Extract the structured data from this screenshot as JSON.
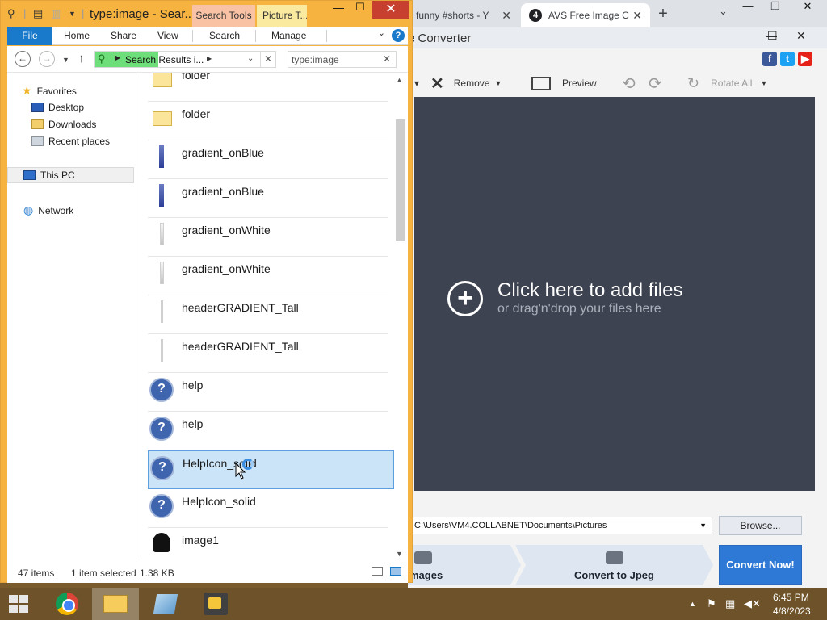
{
  "browser": {
    "tab1_title": "funny #shorts - Y",
    "tab2_title": "AVS Free Image C",
    "tab2_badge": "4",
    "new_tab": "+",
    "tab_search": "⌄",
    "minimize": "—",
    "restore": "❐",
    "close": "✕"
  },
  "avs": {
    "title": "e Converter",
    "minimize": "—",
    "maximize": "☐",
    "close": "✕",
    "toolbar": {
      "remove": "Remove",
      "preview": "Preview",
      "rotate_all": "Rotate All"
    },
    "canvas": {
      "add_main": "Click here to add files",
      "add_sub": "or drag'n'drop your files here"
    },
    "output_path": "C:\\Users\\VM4.COLLABNET\\Documents\\Pictures",
    "browse": "Browse...",
    "step1_label": "mages",
    "step2_label": "Convert to Jpeg",
    "convert_now": "Convert Now!"
  },
  "explorer": {
    "title": "type:image - Sear...",
    "ctx_search_tools": "Search Tools",
    "ctx_picture_tools": "Picture T...",
    "ribbon_tabs": [
      "File",
      "Home",
      "Share",
      "View",
      "Search",
      "Manage"
    ],
    "address": "Search Results i...",
    "search_query": "type:image",
    "nav": {
      "favorites": "Favorites",
      "desktop": "Desktop",
      "downloads": "Downloads",
      "recent": "Recent places",
      "this_pc": "This PC",
      "network": "Network"
    },
    "files": [
      {
        "name": "folder",
        "icon": "folder-icon"
      },
      {
        "name": "folder",
        "icon": "folder-icon"
      },
      {
        "name": "gradient_onBlue",
        "icon": "gradient-blue-icon"
      },
      {
        "name": "gradient_onBlue",
        "icon": "gradient-blue-icon"
      },
      {
        "name": "gradient_onWhite",
        "icon": "gradient-white-icon"
      },
      {
        "name": "gradient_onWhite",
        "icon": "gradient-white-icon"
      },
      {
        "name": "headerGRADIENT_Tall",
        "icon": "header-gradient-icon"
      },
      {
        "name": "headerGRADIENT_Tall",
        "icon": "header-gradient-icon"
      },
      {
        "name": "help",
        "icon": "help-icon"
      },
      {
        "name": "help",
        "icon": "help-icon"
      },
      {
        "name": "HelpIcon_solid",
        "icon": "help-icon",
        "selected": true
      },
      {
        "name": "HelpIcon_solid",
        "icon": "help-icon"
      },
      {
        "name": "image1",
        "icon": "image-icon"
      }
    ],
    "status": {
      "count": "47 items",
      "selected": "1 item selected",
      "size": "1.38 KB"
    }
  },
  "taskbar": {
    "time": "6:45 PM",
    "date": "4/8/2023"
  },
  "colors": {
    "explorer_frame": "#f6b33f",
    "avs_canvas": "#3d4350",
    "convert_button": "#2e79d6",
    "selection": "#cce4f7",
    "taskbar": "#6e532a"
  }
}
